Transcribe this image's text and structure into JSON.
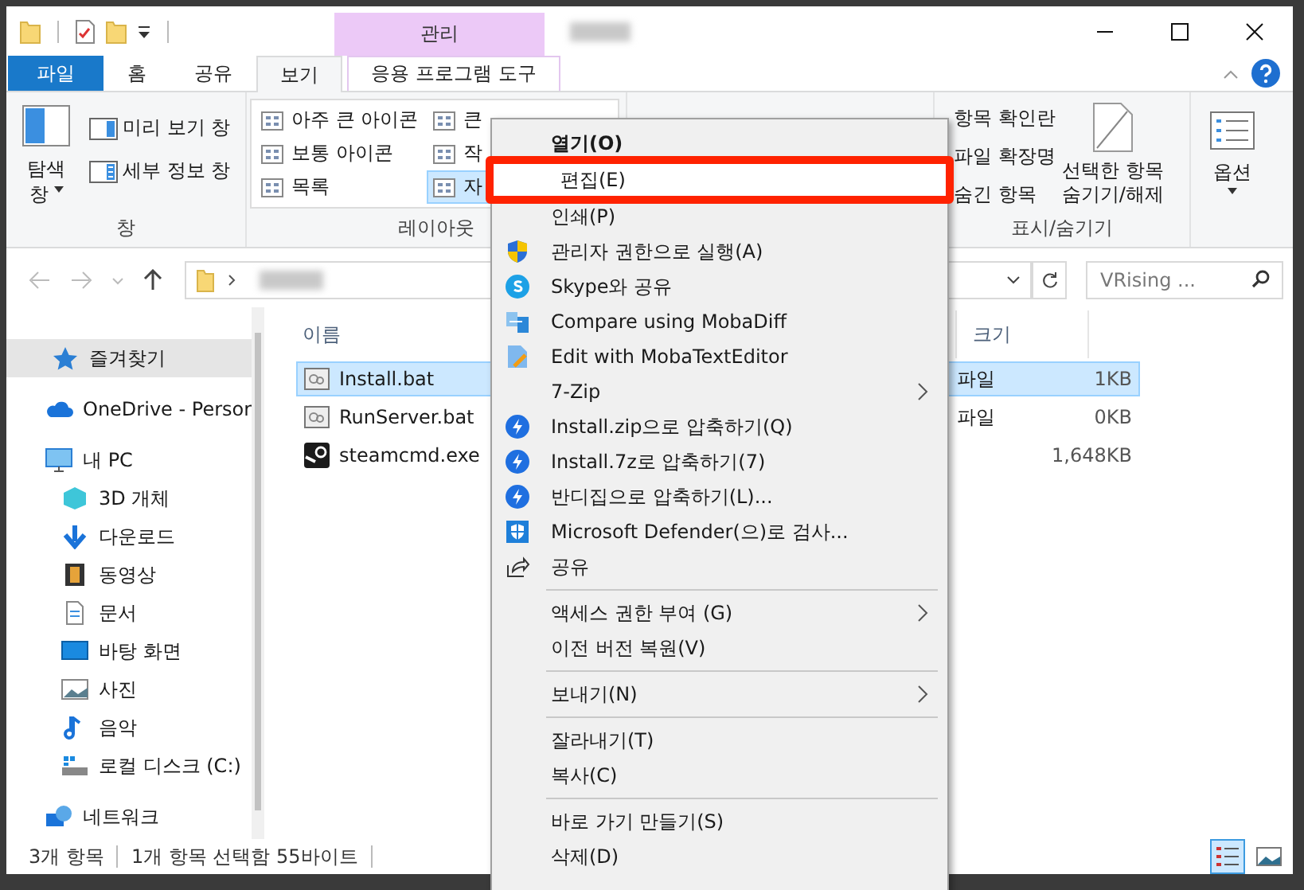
{
  "title_bar": {
    "contextual_header": "관리"
  },
  "ribbon_tabs": [
    {
      "label": "파일",
      "kind": "file",
      "selected": false
    },
    {
      "label": "홈",
      "kind": "tab",
      "selected": false
    },
    {
      "label": "공유",
      "kind": "tab",
      "selected": false
    },
    {
      "label": "보기",
      "kind": "tab",
      "selected": true
    },
    {
      "label": "응용 프로그램 도구",
      "kind": "contextual",
      "selected": false
    }
  ],
  "pane_group": {
    "title": "창",
    "navigation_pane": [
      "탐색",
      "창"
    ],
    "preview_pane": "미리 보기 창",
    "details_pane": "세부 정보 창"
  },
  "layout_group": {
    "title": "레이아웃",
    "options": [
      {
        "label": "아주 큰 아이콘",
        "selected": false
      },
      {
        "label": "큰",
        "selected": false
      },
      {
        "label": "보통 아이콘",
        "selected": false
      },
      {
        "label": "작",
        "selected": false
      },
      {
        "label": "목록",
        "selected": false
      },
      {
        "label": "자",
        "selected": true
      }
    ]
  },
  "show_hide_group": {
    "title": "표시/숨기기",
    "options": [
      "항목 확인란",
      "파일 확장명",
      "숨긴 항목"
    ],
    "hide_selected": [
      "선택한 항목",
      "숨기기/해제"
    ]
  },
  "options_button": {
    "label": "옵션"
  },
  "navigation": {
    "search_placeholder": "VRising ..."
  },
  "sidebar": {
    "items": [
      {
        "label": "즐겨찾기",
        "selected": true
      },
      {
        "label": "OneDrive - Persor",
        "selected": false
      },
      {
        "label": "내 PC",
        "selected": false,
        "children": [
          {
            "label": "3D 개체",
            "selected": false
          },
          {
            "label": "다운로드",
            "selected": false
          },
          {
            "label": "동영상",
            "selected": false
          },
          {
            "label": "문서",
            "selected": false
          },
          {
            "label": "바탕 화면",
            "selected": false
          },
          {
            "label": "사진",
            "selected": false
          },
          {
            "label": "음악",
            "selected": false
          },
          {
            "label": "로컬 디스크 (C:)",
            "selected": false
          }
        ]
      },
      {
        "label": "네트워크",
        "selected": false
      }
    ]
  },
  "file_list": {
    "columns": [
      "이름",
      "크기"
    ],
    "rows": [
      {
        "name": "Install.bat",
        "type": "파일",
        "size": "1KB",
        "selected": true
      },
      {
        "name": "RunServer.bat",
        "type": "파일",
        "size": "0KB",
        "selected": false
      },
      {
        "name": "steamcmd.exe",
        "size": "1,648KB",
        "selected": false
      }
    ]
  },
  "status_bar": {
    "item_count": "3개 항목",
    "selection": "1개 항목 선택함 55바이트",
    "views": [
      {
        "selected": true
      },
      {
        "selected": false
      }
    ]
  },
  "context_menu": {
    "items": [
      {
        "kind": "item",
        "label": "열기(O)",
        "default": true,
        "submenu": false,
        "highlighted": false
      },
      {
        "kind": "item",
        "label": "편집(E)",
        "default": false,
        "submenu": false,
        "highlighted": true
      },
      {
        "kind": "item",
        "label": "인쇄(P)",
        "default": false,
        "submenu": false,
        "highlighted": false
      },
      {
        "kind": "item",
        "label": "관리자 권한으로 실행(A)",
        "default": false,
        "submenu": false,
        "highlighted": false
      },
      {
        "kind": "item",
        "label": "Skype와 공유",
        "default": false,
        "submenu": false,
        "highlighted": false
      },
      {
        "kind": "item",
        "label": "Compare using MobaDiff",
        "default": false,
        "submenu": false,
        "highlighted": false
      },
      {
        "kind": "item",
        "label": "Edit with MobaTextEditor",
        "default": false,
        "submenu": false,
        "highlighted": false
      },
      {
        "kind": "item",
        "label": "7-Zip",
        "default": false,
        "submenu": true,
        "highlighted": false
      },
      {
        "kind": "item",
        "label": "Install.zip으로 압축하기(Q)",
        "default": false,
        "submenu": false,
        "highlighted": false
      },
      {
        "kind": "item",
        "label": "Install.7z로 압축하기(7)",
        "default": false,
        "submenu": false,
        "highlighted": false
      },
      {
        "kind": "item",
        "label": "반디집으로 압축하기(L)...",
        "default": false,
        "submenu": false,
        "highlighted": false
      },
      {
        "kind": "item",
        "label": "Microsoft Defender(으)로 검사...",
        "default": false,
        "submenu": false,
        "highlighted": false
      },
      {
        "kind": "item",
        "label": "공유",
        "default": false,
        "submenu": false,
        "highlighted": false
      },
      {
        "kind": "separator"
      },
      {
        "kind": "item",
        "label": "액세스 권한 부여 (G)",
        "default": false,
        "submenu": true,
        "highlighted": false
      },
      {
        "kind": "item",
        "label": "이전 버전 복원(V)",
        "default": false,
        "submenu": false,
        "highlighted": false
      },
      {
        "kind": "separator"
      },
      {
        "kind": "item",
        "label": "보내기(N)",
        "default": false,
        "submenu": true,
        "highlighted": false
      },
      {
        "kind": "separator"
      },
      {
        "kind": "item",
        "label": "잘라내기(T)",
        "default": false,
        "submenu": false,
        "highlighted": false
      },
      {
        "kind": "item",
        "label": "복사(C)",
        "default": false,
        "submenu": false,
        "highlighted": false
      },
      {
        "kind": "separator"
      },
      {
        "kind": "item",
        "label": "바로 가기 만들기(S)",
        "default": false,
        "submenu": false,
        "highlighted": false
      },
      {
        "kind": "item",
        "label": "삭제(D)",
        "default": false,
        "submenu": false,
        "highlighted": false
      }
    ]
  }
}
